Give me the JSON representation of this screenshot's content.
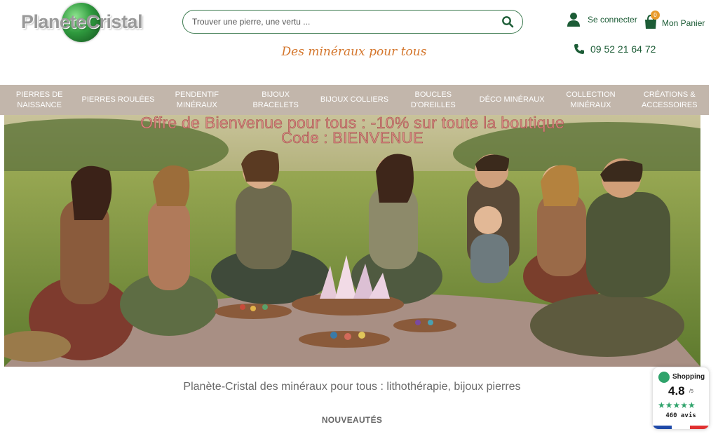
{
  "header": {
    "logo_text": "PlaneteCristal",
    "search": {
      "placeholder": "Trouver une pierre, une vertu ..."
    },
    "tagline": "Des minéraux pour tous",
    "login_label": "Se connecter",
    "cart_label": "Mon Panier",
    "cart_count": "0",
    "phone": "09 52 21 64 72"
  },
  "nav": {
    "items": [
      {
        "label": "PIERRES DE NAISSANCE"
      },
      {
        "label": "PIERRES ROULÉES"
      },
      {
        "label": "PENDENTIF MINÉRAUX"
      },
      {
        "label": "BIJOUX BRACELETS"
      },
      {
        "label": "BIJOUX COLLIERS"
      },
      {
        "label": "BOUCLES D'OREILLES"
      },
      {
        "label": "DÉCO MINÉRAUX"
      },
      {
        "label": "COLLECTION MINÉRAUX"
      },
      {
        "label": "CRÉATIONS & ACCESSOIRES"
      }
    ]
  },
  "banner": {
    "line1": "Offre de Bienvenue pour tous : -10% sur toute la boutique",
    "line2": "Code : BIENVENUE"
  },
  "main": {
    "intro": "Planète-Cristal des minéraux pour tous : lithothérapie, bijoux pierres",
    "section_title": "NOUVEAUTÉS"
  },
  "rating": {
    "brand": "Shopping",
    "score": "4.8",
    "max": "/5",
    "stars": "★★★★★",
    "count": "460 avis"
  },
  "colors": {
    "brand_green": "#1c5c36",
    "accent_orange": "#d4762c",
    "nav_bg": "#c2b6ab"
  }
}
